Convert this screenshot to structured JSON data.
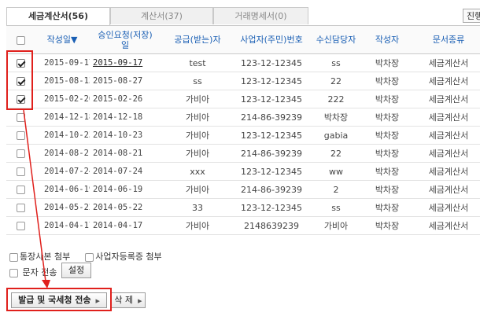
{
  "tabs": [
    {
      "label": "세금계산서(56)"
    },
    {
      "label": "계산서(37)"
    },
    {
      "label": "거래명세서(0)"
    }
  ],
  "status_select": {
    "value": "진행"
  },
  "table": {
    "headers": [
      "작성일▼",
      "승인요청(저장)일",
      "공급(받는)자",
      "사업자(주민)번호",
      "수신담당자",
      "작성자",
      "문서종류"
    ],
    "rows": [
      {
        "checked": true,
        "date": "2015-09-17",
        "approval": "2015-09-17",
        "supplier": "test",
        "biz_no": "123-12-12345",
        "recipient": "ss",
        "writer": "박차장",
        "doc_type": "세금계산서"
      },
      {
        "checked": true,
        "date": "2015-08-13",
        "approval": "2015-08-27",
        "supplier": "ss",
        "biz_no": "123-12-12345",
        "recipient": "22",
        "writer": "박차장",
        "doc_type": "세금계산서"
      },
      {
        "checked": true,
        "date": "2015-02-26",
        "approval": "2015-02-26",
        "supplier": "가비아",
        "biz_no": "123-12-12345",
        "recipient": "222",
        "writer": "박차장",
        "doc_type": "세금계산서"
      },
      {
        "checked": false,
        "date": "2014-12-18",
        "approval": "2014-12-18",
        "supplier": "가비아",
        "biz_no": "214-86-39239",
        "recipient": "박차장",
        "writer": "박차장",
        "doc_type": "세금계산서"
      },
      {
        "checked": false,
        "date": "2014-10-23",
        "approval": "2014-10-23",
        "supplier": "가비아",
        "biz_no": "123-12-12345",
        "recipient": "gabia",
        "writer": "박차장",
        "doc_type": "세금계산서"
      },
      {
        "checked": false,
        "date": "2014-08-21",
        "approval": "2014-08-21",
        "supplier": "가비아",
        "biz_no": "214-86-39239",
        "recipient": "22",
        "writer": "박차장",
        "doc_type": "세금계산서"
      },
      {
        "checked": false,
        "date": "2014-07-24",
        "approval": "2014-07-24",
        "supplier": "xxx",
        "biz_no": "123-12-12345",
        "recipient": "ww",
        "writer": "박차장",
        "doc_type": "세금계산서"
      },
      {
        "checked": false,
        "date": "2014-06-19",
        "approval": "2014-06-19",
        "supplier": "가비아",
        "biz_no": "214-86-39239",
        "recipient": "2",
        "writer": "박차장",
        "doc_type": "세금계산서"
      },
      {
        "checked": false,
        "date": "2014-05-22",
        "approval": "2014-05-22",
        "supplier": "33",
        "biz_no": "123-12-12345",
        "recipient": "ss",
        "writer": "박차장",
        "doc_type": "세금계산서"
      },
      {
        "checked": false,
        "date": "2014-04-17",
        "approval": "2014-04-17",
        "supplier": "가비아",
        "biz_no": "2148639239",
        "recipient": "가비아",
        "writer": "박차장",
        "doc_type": "세금계산서"
      }
    ]
  },
  "options": {
    "attach_bankbook": "통장사본 첨부",
    "attach_bizreg": "사업자등록증 첨부",
    "sms_send": "문자 전송",
    "settings_button": "설정"
  },
  "actions": {
    "issue_button": "발급 및 국세청 전송",
    "delete_button": "삭 제"
  },
  "colors": {
    "highlight": "#e0201c",
    "header_text": "#1a5fb4"
  }
}
